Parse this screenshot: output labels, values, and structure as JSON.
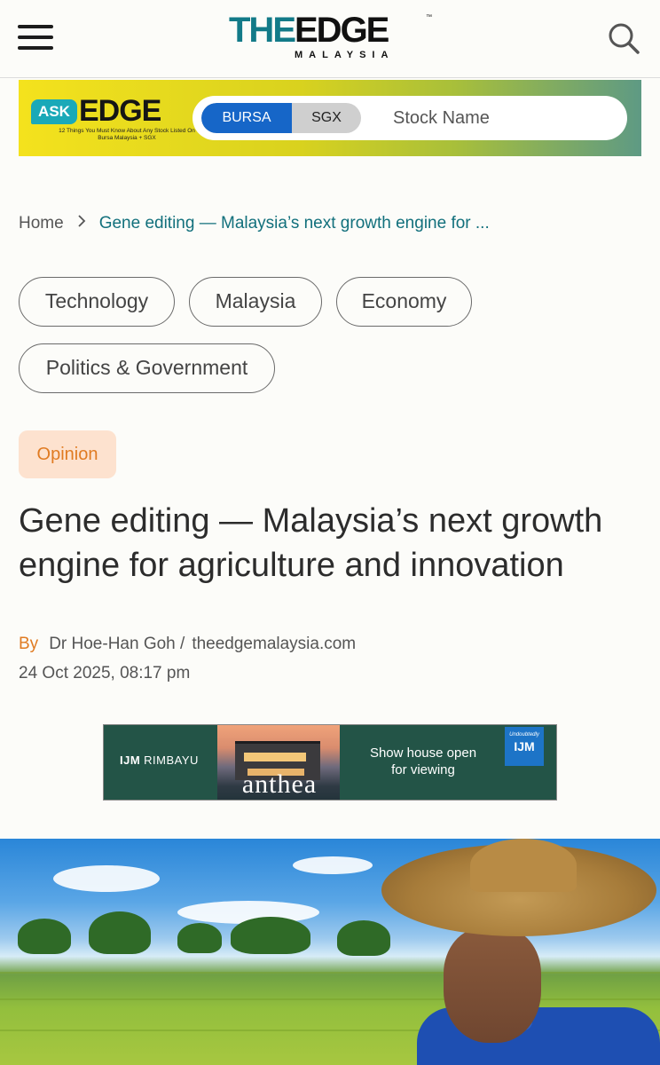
{
  "header": {
    "logo_the": "THE",
    "logo_edge": "EDGE",
    "logo_tm": "™",
    "logo_sub": "MALAYSIA",
    "menu_icon": "hamburger-menu-icon",
    "search_icon": "search-icon"
  },
  "ask_banner": {
    "ask": "ASK",
    "edge": "EDGE",
    "tagline": "12 Things You Must Know About Any Stock Listed On Bursa Malaysia + SGX",
    "tab_bursa": "BURSA",
    "tab_sgx": "SGX",
    "selected_tab": "BURSA",
    "search_placeholder": "Stock Name"
  },
  "breadcrumb": {
    "home": "Home",
    "separator_icon": "chevron-right-icon",
    "current": "Gene editing — Malaysia’s next growth engine for ..."
  },
  "tags": [
    "Technology",
    "Malaysia",
    "Economy",
    "Politics & Government"
  ],
  "category": "Opinion",
  "article": {
    "title": "Gene editing — Malaysia’s next growth engine for agriculture and innovation",
    "by_label": "By",
    "author": "Dr Hoe-Han Goh /",
    "source": "theedgemalaysia.com",
    "date": "24 Oct 2025, 08:17 pm"
  },
  "ad": {
    "brand_a": "IJM",
    "brand_b": "RIMBAYU",
    "project": "anthea",
    "text_line1": "Show house open",
    "text_line2": "for viewing",
    "badge_small": "Undoubtedly",
    "badge": "IJM"
  },
  "colors": {
    "accent_teal": "#12707c",
    "opinion_orange": "#e07b22",
    "bursa_blue": "#1666c8"
  }
}
